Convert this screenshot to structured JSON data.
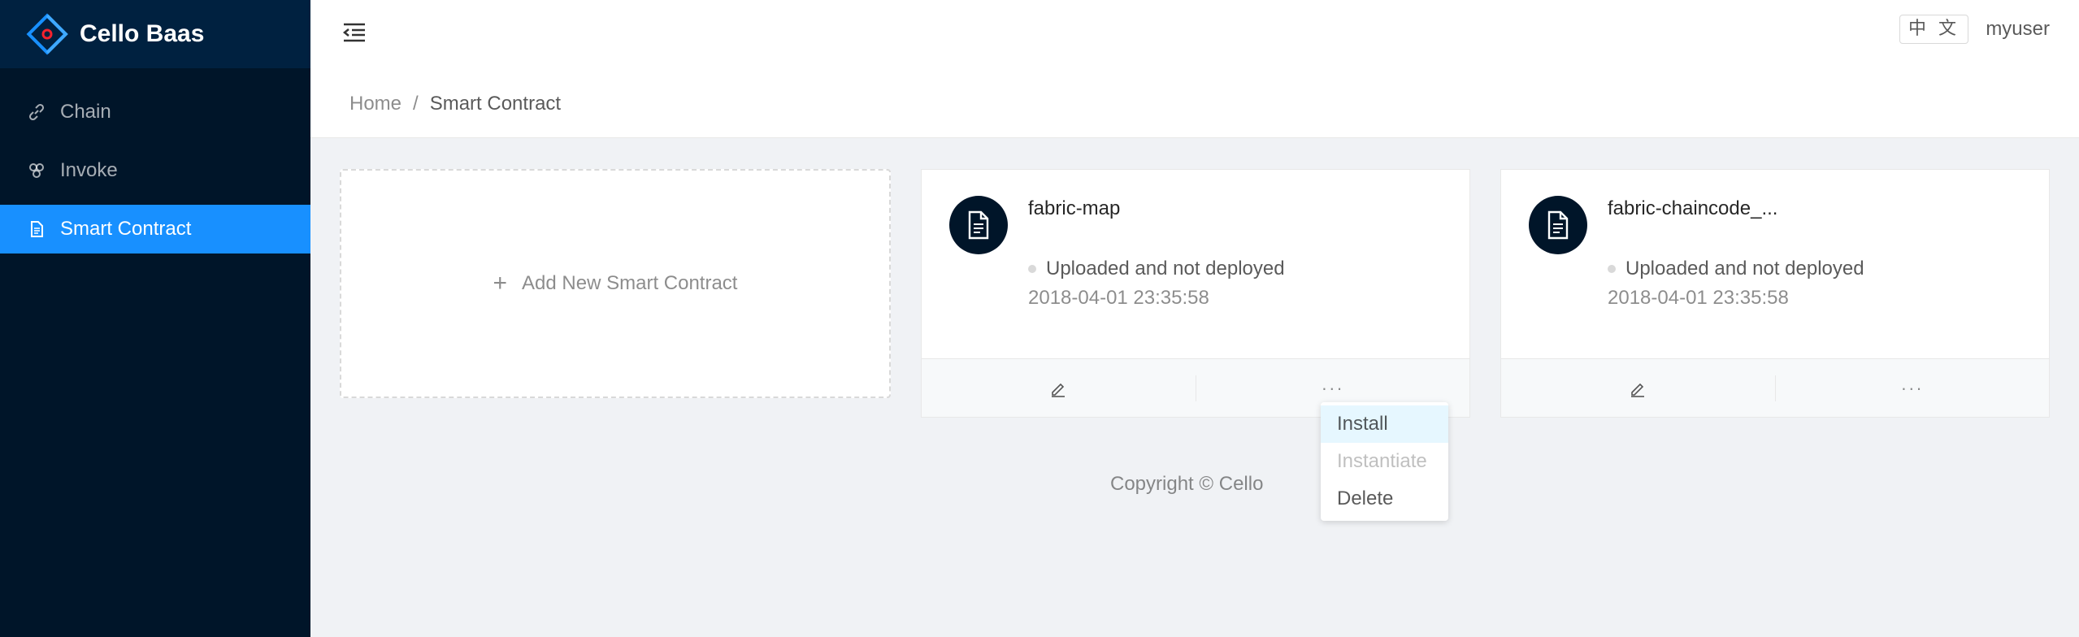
{
  "app": {
    "title": "Cello Baas",
    "logo_icon": "cello-logo-icon"
  },
  "sidebar": {
    "items": [
      {
        "label": "Chain",
        "icon": "link-icon",
        "active": false
      },
      {
        "label": "Invoke",
        "icon": "deployment-unit-icon",
        "active": false
      },
      {
        "label": "Smart Contract",
        "icon": "file-icon",
        "active": true
      }
    ]
  },
  "header": {
    "menu_toggle_icon": "menu-fold-icon",
    "language": "中 文",
    "user": "myuser"
  },
  "breadcrumb": {
    "home": "Home",
    "separator": "/",
    "current": "Smart Contract"
  },
  "add_card": {
    "label": "Add New Smart Contract",
    "icon": "plus-icon"
  },
  "contracts": [
    {
      "name": "fabric-map",
      "status": "Uploaded and not deployed",
      "date": "2018-04-01 23:35:58",
      "more": "···"
    },
    {
      "name": "fabric-chaincode_...",
      "status": "Uploaded and not deployed",
      "date": "2018-04-01 23:35:58",
      "more": "···"
    }
  ],
  "dropdown": {
    "items": [
      {
        "label": "Install",
        "hovered": true,
        "disabled": false
      },
      {
        "label": "Instantiate",
        "hovered": false,
        "disabled": true
      },
      {
        "label": "Delete",
        "hovered": false,
        "disabled": false
      }
    ]
  },
  "footer": {
    "copyright": "Copyright © Cello"
  },
  "colors": {
    "sidebar_bg": "#001529",
    "logo_bg": "#002140",
    "primary": "#1890ff",
    "page_bg": "#f0f2f5",
    "status_dot": "#d9d9d9"
  }
}
